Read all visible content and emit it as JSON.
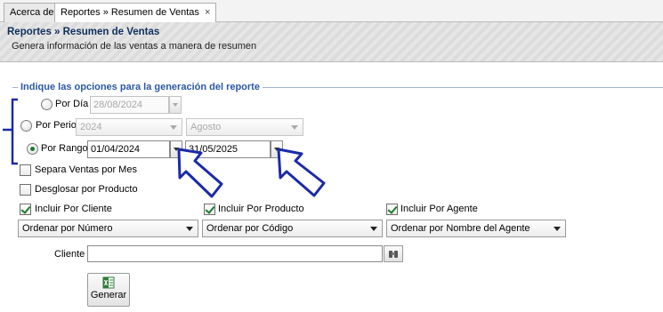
{
  "tabs": [
    {
      "label": "Acerca de"
    },
    {
      "label": "Reportes » Resumen de Ventas",
      "close": "×"
    }
  ],
  "header": {
    "title": "Reportes » Resumen de Ventas",
    "subtitle": "Genera información de las ventas a manera de resumen"
  },
  "group": {
    "title": "Indique las opciones para la generación del reporte"
  },
  "por_dia": {
    "label": "Por Día",
    "date": "28/08/2024",
    "selected": false
  },
  "por_periodo": {
    "label": "Por Periodo",
    "year": "2024",
    "month": "Agosto",
    "selected": false
  },
  "por_rango": {
    "label": "Por Rango",
    "from": "01/04/2024",
    "to": "31/05/2025",
    "selected": true
  },
  "options": {
    "separa_ventas": {
      "label": "Separa Ventas por Mes",
      "checked": false
    },
    "desglosar": {
      "label": "Desglosar por Producto",
      "checked": false
    },
    "cliente": {
      "label": "Incluir Por Cliente",
      "checked": true
    },
    "producto": {
      "label": "Incluir Por Producto",
      "checked": true
    },
    "agente": {
      "label": "Incluir Por Agente",
      "checked": true
    }
  },
  "orders": {
    "cliente": "Ordenar por Número",
    "producto": "Ordenar por Código",
    "agente": "Ordenar por Nombre del Agente"
  },
  "cliente_field": {
    "label": "Cliente",
    "value": ""
  },
  "generate_button": {
    "label": "Generar"
  },
  "colors": {
    "annotation": "#1c2aa8",
    "group_title": "#2b58a6",
    "check": "#1d7d2e"
  }
}
